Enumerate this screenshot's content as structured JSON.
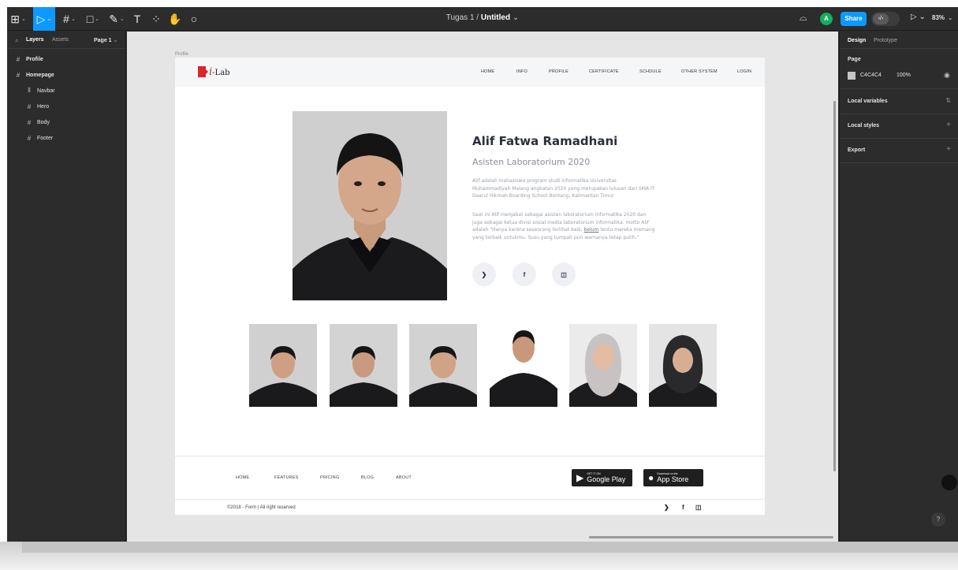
{
  "toolbar": {
    "tools": [
      {
        "name": "main-menu",
        "glyph": "⊞",
        "caret": "⌄"
      },
      {
        "name": "move",
        "glyph": "▷",
        "caret": "⌄"
      },
      {
        "name": "frame",
        "glyph": "#",
        "caret": "⌄"
      },
      {
        "name": "shape",
        "glyph": "□",
        "caret": "⌄"
      },
      {
        "name": "pen",
        "glyph": "✎",
        "caret": "⌄"
      },
      {
        "name": "text",
        "glyph": "T",
        "caret": ""
      },
      {
        "name": "components",
        "glyph": "⁘",
        "caret": ""
      },
      {
        "name": "hand",
        "glyph": "✋",
        "caret": ""
      },
      {
        "name": "comment",
        "glyph": "○",
        "caret": ""
      }
    ],
    "project": "Tugas 1",
    "separator": "/",
    "file_name": "Untitled",
    "file_caret": "⌄",
    "headphone_glyph": "⌓",
    "avatar_initial": "A",
    "share_label": "Share",
    "dev_mode_glyph": "‹/›",
    "play_glyph": "▷ ⌄",
    "zoom": "83%",
    "zoom_caret": "⌄"
  },
  "left_panel": {
    "search_glyph": "⌕",
    "tabs": [
      "Layers",
      "Assets"
    ],
    "page_selector": "Page 1",
    "page_caret": "⌄",
    "layers": [
      {
        "name": "Profile",
        "glyph": "#",
        "level": 0
      },
      {
        "name": "Homepage",
        "glyph": "#",
        "level": 0
      },
      {
        "name": "Navbar",
        "glyph": "⦀",
        "level": 1
      },
      {
        "name": "Hero",
        "glyph": "#",
        "level": 1
      },
      {
        "name": "Body",
        "glyph": "#",
        "level": 1
      },
      {
        "name": "Footer",
        "glyph": "#",
        "level": 1
      }
    ]
  },
  "canvas": {
    "frame_label": "Profile",
    "site": {
      "logo_i": "i",
      "logo_text": "-Lab",
      "nav": [
        "HOME",
        "INFO",
        "PROFILE",
        "CERTIFICATE",
        "SCHDULE",
        "OTHER SYSTEM",
        "LOGIN"
      ],
      "hero": {
        "name": "Alif Fatwa Ramadhani",
        "role": "Asisten Laboratorium 2020",
        "para1": "Alif adalah mahasiswa program studi informatika  Universitas Muhammadiyah Malang angkatan 2020 yang merupakan lulusan dari SMA IT Daarul Hikmah Boarding School Bontang, Kalimantan Timur",
        "para2_a": "Saat ini Alif menjabat sebagai asisten laboratorium informatika 2020 dan juga sebagai ketua divisi sosial media laboratorium informatika. motto Alif adalah \"Hanya karena seseorang terlihat baik,",
        "para2_u": "belum",
        "para2_b": "tentu mereka memang yang terbaik untukmu. Susu yang tumpah pun warnanya tetap putih.\"",
        "social": [
          "❯",
          "f",
          "◫"
        ]
      },
      "footer": {
        "links": [
          "HOME",
          "FEATURES",
          "PRICING",
          "BLOG",
          "ABOUT"
        ],
        "google_small": "GET IT ON",
        "google_big": "Google Play",
        "apple_small": "Download on the",
        "apple_big": "App Store",
        "copyright": "©2018 - Form  |  All right reserved",
        "social": [
          "❯",
          "f",
          "◫"
        ]
      }
    }
  },
  "right_panel": {
    "tabs": [
      "Design",
      "Prototype"
    ],
    "page_section": "Page",
    "page_color": "C4C4C4",
    "page_opacity": "100%",
    "eye_glyph": "◉",
    "sections": [
      {
        "title": "Local variables",
        "action": "⇅"
      },
      {
        "title": "Local styles",
        "action": "+"
      },
      {
        "title": "Export",
        "action": "+"
      }
    ],
    "help": "?"
  }
}
